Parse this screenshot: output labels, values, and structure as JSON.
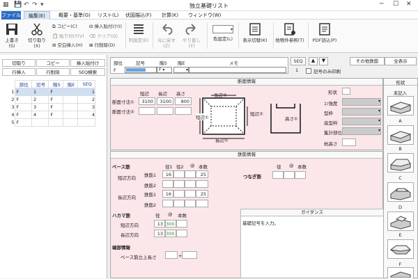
{
  "titlebar": {
    "title": "独立基礎リスト",
    "file_tab": "ファイル"
  },
  "menus": [
    "編集(E)",
    "概要・基準(G)",
    "リスト(L)",
    "伏図描込(F)",
    "計算(K)",
    "ウィンドウ(W)"
  ],
  "ribbon": {
    "overwrite": "上書き(S)",
    "cut": "切り取り(X)",
    "copy": "コピー(C)",
    "paste": "貼り付け(V)",
    "blank_insert": "空白挿入(H)",
    "insert_paste": "挿入貼付け(I)",
    "clear": "クリア(Q)",
    "row_delete": "行削除(D)",
    "col_config": "列設定(E)",
    "undo": "元に戻す(Z)",
    "redo": "やり直し(Y)",
    "color_setting": "色設定(L)",
    "display_switch": "表示切替(K)",
    "other_ref": "他物件参照(T)",
    "pdf": "PDF読込(P)"
  },
  "left": {
    "buttons": [
      "切取り",
      "コピー",
      "挿入貼付け",
      "行挿入",
      "行削除",
      "SEQ検索"
    ],
    "headers": [
      "部位",
      "記号",
      "階S",
      "階E",
      "SEQ"
    ],
    "rows": [
      [
        "F",
        "1",
        "F",
        "",
        "1"
      ],
      [
        "F",
        "2",
        "F",
        "",
        "2"
      ],
      [
        "F",
        "3",
        "F",
        "",
        "3"
      ],
      [
        "F",
        "4",
        "F",
        "",
        "4"
      ],
      [
        "F",
        "",
        "",
        "",
        ""
      ]
    ],
    "row_nums": [
      "1",
      "2",
      "3",
      "4",
      "5"
    ]
  },
  "header": {
    "cols": [
      "部位",
      "記号",
      "階S",
      "階E",
      "メモ"
    ],
    "vals": [
      "F",
      "",
      "F",
      ""
    ],
    "seq": "SEQ",
    "seq_val": "1",
    "print_label": "記号のみ印刷",
    "other_btn": "その他鉄筋",
    "all_table_btn": "全表示"
  },
  "section": {
    "title": "断面情報",
    "col_labels": [
      "短辺",
      "長辺",
      "高さ"
    ],
    "row1": "断面寸法①",
    "row2": "断面寸法②",
    "v1": [
      "3100",
      "3100",
      "800"
    ],
    "diagram": {
      "long2": "長辺②",
      "short1": "短辺①",
      "short2": "短辺②",
      "long1": "長辺①",
      "height1": "高さ①"
    },
    "fields": [
      "形状",
      "ｺﾝ強度",
      "型枠",
      "底型枠",
      "集計部位",
      "杭高さ"
    ]
  },
  "rebar": {
    "title": "鉄筋情報",
    "base": "ベース筋",
    "diam": [
      "径1",
      "径2",
      "@",
      "本数"
    ],
    "short_dir": "短辺方向",
    "long_dir": "長辺方向",
    "bar1": "鉄筋1",
    "bar2": "鉄筋2",
    "short_vals": [
      "16",
      "25"
    ],
    "long_vals": [
      "16",
      "25"
    ],
    "tie": "つなぎ筋",
    "tie_cols": [
      "径",
      "@",
      "本数"
    ],
    "hakama": "ハカマ筋",
    "hk_cols": [
      "径",
      "@",
      "本数"
    ],
    "hk_short": [
      "13",
      "300"
    ],
    "hk_long": [
      "13",
      "300"
    ],
    "end": "端部情報",
    "base_len": "ベース筋立上長さ",
    "plus": "+"
  },
  "guidance": {
    "title": "ガイダンス",
    "text": "基礎記号を入力。"
  },
  "shapes": {
    "title": "形状",
    "unset": "未記入",
    "labels": [
      "A",
      "B",
      "C",
      "D",
      "E",
      "F"
    ]
  }
}
